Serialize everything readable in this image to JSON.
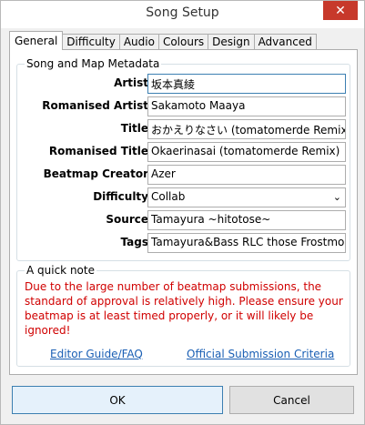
{
  "window": {
    "title": "Song Setup",
    "close_glyph": "✕"
  },
  "tabs": [
    "General",
    "Difficulty",
    "Audio",
    "Colours",
    "Design",
    "Advanced"
  ],
  "metadata": {
    "legend": "Song and Map Metadata",
    "fields": [
      {
        "label": "Artist",
        "value": "坂本真綾"
      },
      {
        "label": "Romanised Artist",
        "value": "Sakamoto Maaya"
      },
      {
        "label": "Title",
        "value": "おかえりなさい (tomatomerde Remix)"
      },
      {
        "label": "Romanised Title",
        "value": "Okaerinasai (tomatomerde Remix)"
      },
      {
        "label": "Beatmap Creator",
        "value": "Azer"
      },
      {
        "label": "Difficulty",
        "value": "Collab"
      },
      {
        "label": "Source",
        "value": "Tamayura ~hitotose~"
      },
      {
        "label": "Tags",
        "value": "Tamayura&Bass RLC those Frostmourne"
      }
    ]
  },
  "note": {
    "legend": "A quick note",
    "text": "Due to the large number of beatmap submissions, the standard of approval is relatively high.  Please ensure your beatmap is at least timed properly, or it will likely be ignored!",
    "links": [
      "Editor Guide/FAQ",
      "Official Submission Criteria"
    ]
  },
  "buttons": {
    "ok": "OK",
    "cancel": "Cancel"
  },
  "colors": {
    "note_text": "#d00000",
    "link": "#1a5fb4",
    "close": "#c7392b"
  }
}
